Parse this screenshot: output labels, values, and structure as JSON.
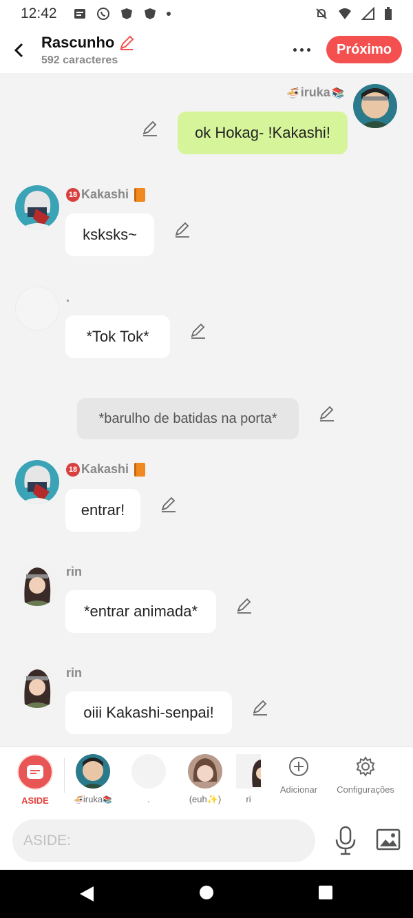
{
  "status": {
    "time": "12:42"
  },
  "header": {
    "title": "Rascunho",
    "subtitle": "592 caracteres",
    "next_label": "Próximo"
  },
  "messages": [
    {
      "sender": "iruka",
      "text": "ok Hokag- !Kakashi!",
      "side": "right"
    },
    {
      "sender": "Kakashi",
      "text": "ksksks~",
      "side": "left"
    },
    {
      "sender": ".",
      "text": "*Tok Tok*",
      "side": "left"
    },
    {
      "sender": "",
      "text": "*barulho de batidas na porta*",
      "side": "narration"
    },
    {
      "sender": "Kakashi",
      "text": "entrar!",
      "side": "left"
    },
    {
      "sender": "rin",
      "text": "*entrar animada*",
      "side": "left"
    },
    {
      "sender": "rin",
      "text": "oiii Kakashi-senpai!",
      "side": "left"
    }
  ],
  "charbar": {
    "aside_label": "ASIDE",
    "characters": [
      {
        "name": "iruka"
      },
      {
        "name": "."
      },
      {
        "name": "(euh✨)"
      },
      {
        "name": "ri"
      }
    ],
    "add_label": "Adicionar",
    "settings_label": "Configurações"
  },
  "input": {
    "placeholder": "ASIDE:"
  },
  "colors": {
    "accent": "#f55050",
    "bubble_green": "#d6f59a",
    "narration": "#e6e6e6"
  }
}
